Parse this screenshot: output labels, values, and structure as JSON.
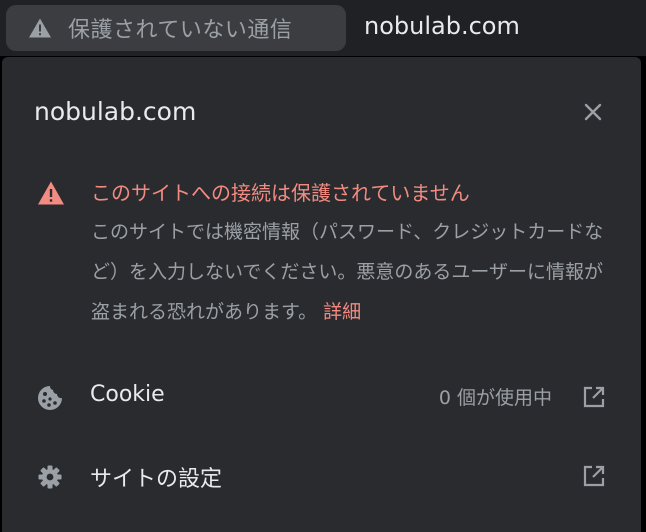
{
  "omnibox": {
    "security_chip_label": "保護されていない通信",
    "security_icon": "warning-triangle-icon",
    "url": "nobulab.com"
  },
  "panel": {
    "site_title": "nobulab.com",
    "close_icon": "close-icon",
    "warning": {
      "icon": "warning-triangle-icon",
      "title": "このサイトへの接続は保護されていません",
      "body": "このサイトでは機密情報（パスワード、クレジットカードなど）を入力しないでください。悪意のあるユーザーに情報が盗まれる恐れがあります。",
      "details_link": "詳細"
    },
    "cookies": {
      "icon": "cookie-icon",
      "label": "Cookie",
      "status": "0 個が使用中",
      "open_icon": "external-link-icon"
    },
    "site_settings": {
      "icon": "gear-icon",
      "label": "サイトの設定",
      "open_icon": "external-link-icon"
    }
  },
  "colors": {
    "panel_bg": "#2a2b2e",
    "omnibox_bg": "#202124",
    "chip_bg": "#3c3d40",
    "text_primary": "#e8eaed",
    "text_secondary": "#9aa0a6",
    "danger": "#f28b82"
  }
}
